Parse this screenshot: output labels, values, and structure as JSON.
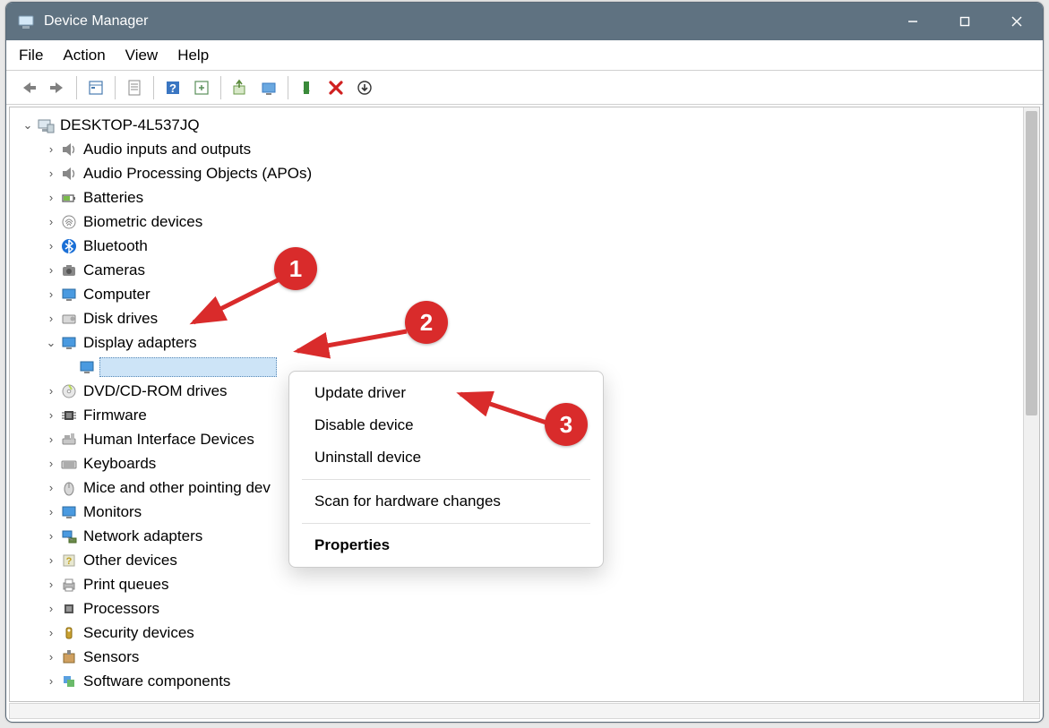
{
  "title": "Device Manager",
  "menubar": [
    "File",
    "Action",
    "View",
    "Help"
  ],
  "root": "DESKTOP-4L537JQ",
  "categories": [
    {
      "label": "Audio inputs and outputs",
      "icon": "speaker"
    },
    {
      "label": "Audio Processing Objects (APOs)",
      "icon": "speaker"
    },
    {
      "label": "Batteries",
      "icon": "battery"
    },
    {
      "label": "Biometric devices",
      "icon": "fingerprint"
    },
    {
      "label": "Bluetooth",
      "icon": "bluetooth"
    },
    {
      "label": "Cameras",
      "icon": "camera"
    },
    {
      "label": "Computer",
      "icon": "monitor"
    },
    {
      "label": "Disk drives",
      "icon": "disk"
    },
    {
      "label": "Display adapters",
      "icon": "monitor",
      "expanded": true,
      "child_selected": true
    },
    {
      "label": "DVD/CD-ROM drives",
      "icon": "cd"
    },
    {
      "label": "Firmware",
      "icon": "chip"
    },
    {
      "label": "Human Interface Devices",
      "icon": "hid"
    },
    {
      "label": "Keyboards",
      "icon": "keyboard"
    },
    {
      "label": "Mice and other pointing dev",
      "icon": "mouse"
    },
    {
      "label": "Monitors",
      "icon": "monitor"
    },
    {
      "label": "Network adapters",
      "icon": "network"
    },
    {
      "label": "Other devices",
      "icon": "other"
    },
    {
      "label": "Print queues",
      "icon": "printer"
    },
    {
      "label": "Processors",
      "icon": "cpu"
    },
    {
      "label": "Security devices",
      "icon": "security"
    },
    {
      "label": "Sensors",
      "icon": "sensor"
    },
    {
      "label": "Software components",
      "icon": "software"
    }
  ],
  "context_menu": {
    "items": [
      {
        "label": "Update driver"
      },
      {
        "label": "Disable device"
      },
      {
        "label": "Uninstall device"
      }
    ],
    "scan": "Scan for hardware changes",
    "properties": "Properties"
  },
  "annotations": {
    "n1": "1",
    "n2": "2",
    "n3": "3"
  }
}
